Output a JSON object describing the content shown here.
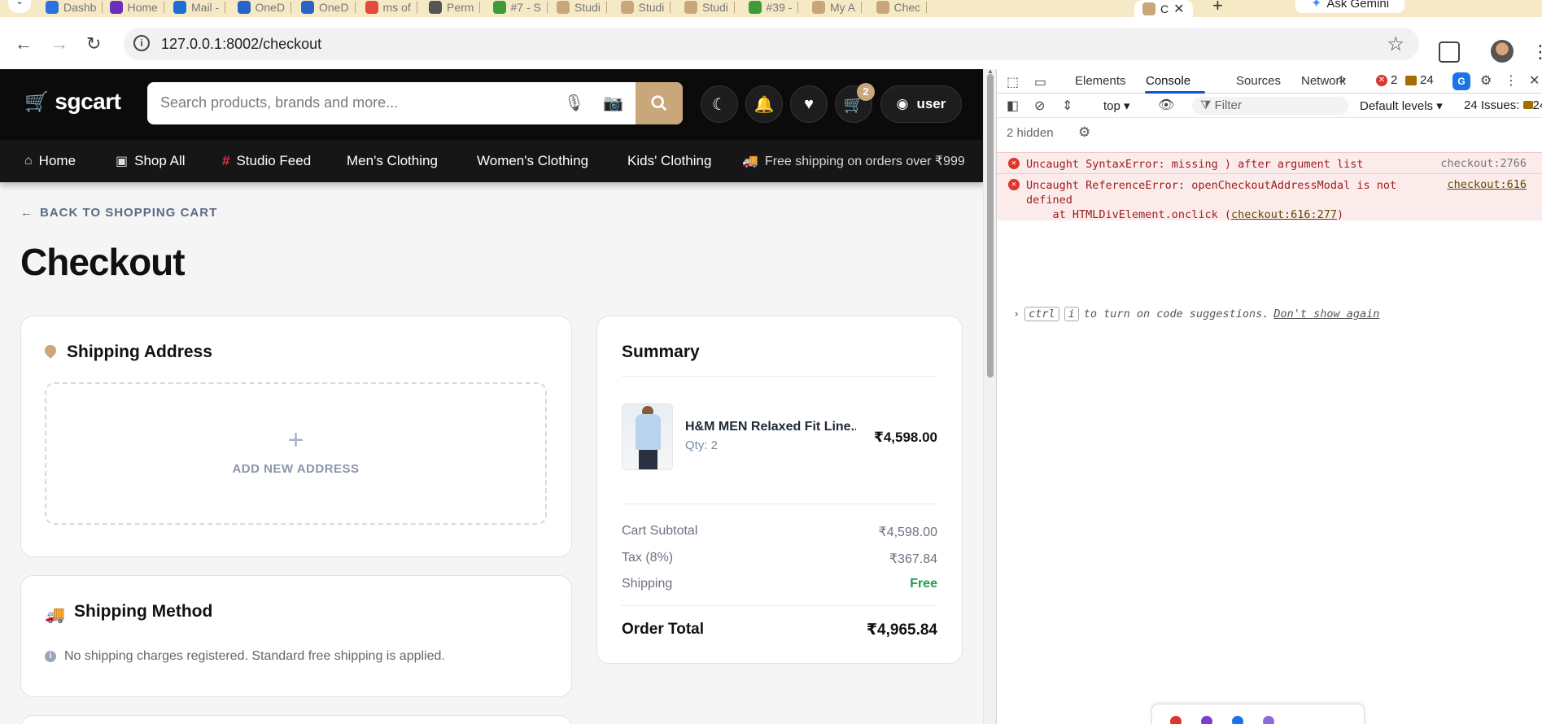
{
  "browser": {
    "tabs": [
      {
        "label": "Dashb",
        "color": "#2f6fde"
      },
      {
        "label": "Home",
        "color": "#6b2fbf"
      },
      {
        "label": "Mail -",
        "color": "#1c6fd1"
      },
      {
        "label": "OneD",
        "color": "#2a64c9"
      },
      {
        "label": "OneD",
        "color": "#2a64c9"
      },
      {
        "label": "ms of",
        "color": "#e24a3b"
      },
      {
        "label": "Perm",
        "color": "#555555"
      },
      {
        "label": "#7 - S",
        "color": "#3c9c3c"
      },
      {
        "label": "Studi",
        "color": "#c9a77b"
      },
      {
        "label": "Studi",
        "color": "#c9a77b"
      },
      {
        "label": "Studi",
        "color": "#c9a77b"
      },
      {
        "label": "#39 -",
        "color": "#3c9c3c"
      },
      {
        "label": "My A",
        "color": "#c9a77b"
      },
      {
        "label": "Chec",
        "color": "#c9a77b"
      }
    ],
    "active_tab_label": "C",
    "close_glyph": "✕",
    "new_tab_glyph": "+",
    "gemini_label": "Ask Gemini",
    "url": "127.0.0.1:8002/checkout"
  },
  "header": {
    "logo_text": "sgcart",
    "search_placeholder": "Search products, brands and more...",
    "cart_count": "2",
    "user_label": "user"
  },
  "nav": {
    "items": [
      {
        "label": "Home",
        "icon": "home-icon"
      },
      {
        "label": "Shop All",
        "icon": "store-icon"
      },
      {
        "label": "Studio Feed",
        "icon": "hash-icon"
      },
      {
        "label": "Men's Clothing",
        "icon": ""
      },
      {
        "label": "Women's Clothing",
        "icon": ""
      },
      {
        "label": "Kids' Clothing",
        "icon": ""
      }
    ],
    "shipping_notice": "Free shipping on orders over ₹999"
  },
  "checkout": {
    "back_label": "BACK TO SHOPPING CART",
    "title": "Checkout",
    "shipping_address": {
      "heading": "Shipping Address",
      "add_label": "ADD NEW ADDRESS"
    },
    "shipping_method": {
      "heading": "Shipping Method",
      "note": "No shipping charges registered. Standard free shipping is applied."
    },
    "summary": {
      "heading": "Summary",
      "item_name": "H&M MEN Relaxed Fit Line...",
      "item_qty": "Qty: 2",
      "item_price": "₹4,598.00",
      "subtotal_label": "Cart Subtotal",
      "subtotal_value": "₹4,598.00",
      "tax_label": "Tax (8%)",
      "tax_value": "₹367.84",
      "shipping_label": "Shipping",
      "shipping_value": "Free",
      "total_label": "Order Total",
      "total_value": "₹4,965.84"
    }
  },
  "devtools": {
    "tabs": [
      "Elements",
      "Console",
      "Sources",
      "Network"
    ],
    "active_tab": "Console",
    "error_count": "2",
    "warning_count": "24",
    "context": "top",
    "filter_placeholder": "Filter",
    "levels": "Default levels",
    "issues": "24 Issues:",
    "issues_count": "24",
    "hidden": "2 hidden",
    "messages": [
      {
        "text": "Uncaught SyntaxError: missing ) after argument list",
        "source": "checkout:2766"
      },
      {
        "text": "Uncaught ReferenceError: openCheckoutAddressModal is not\ndefined\n    at HTMLDivElement.onclick (",
        "link": "checkout:616:277",
        "after": ")",
        "source": "checkout:616"
      }
    ],
    "hint_ctrl": "ctrl",
    "hint_i": "i",
    "hint_text": "to turn on code suggestions.",
    "hint_dismiss": "Don't show again"
  }
}
